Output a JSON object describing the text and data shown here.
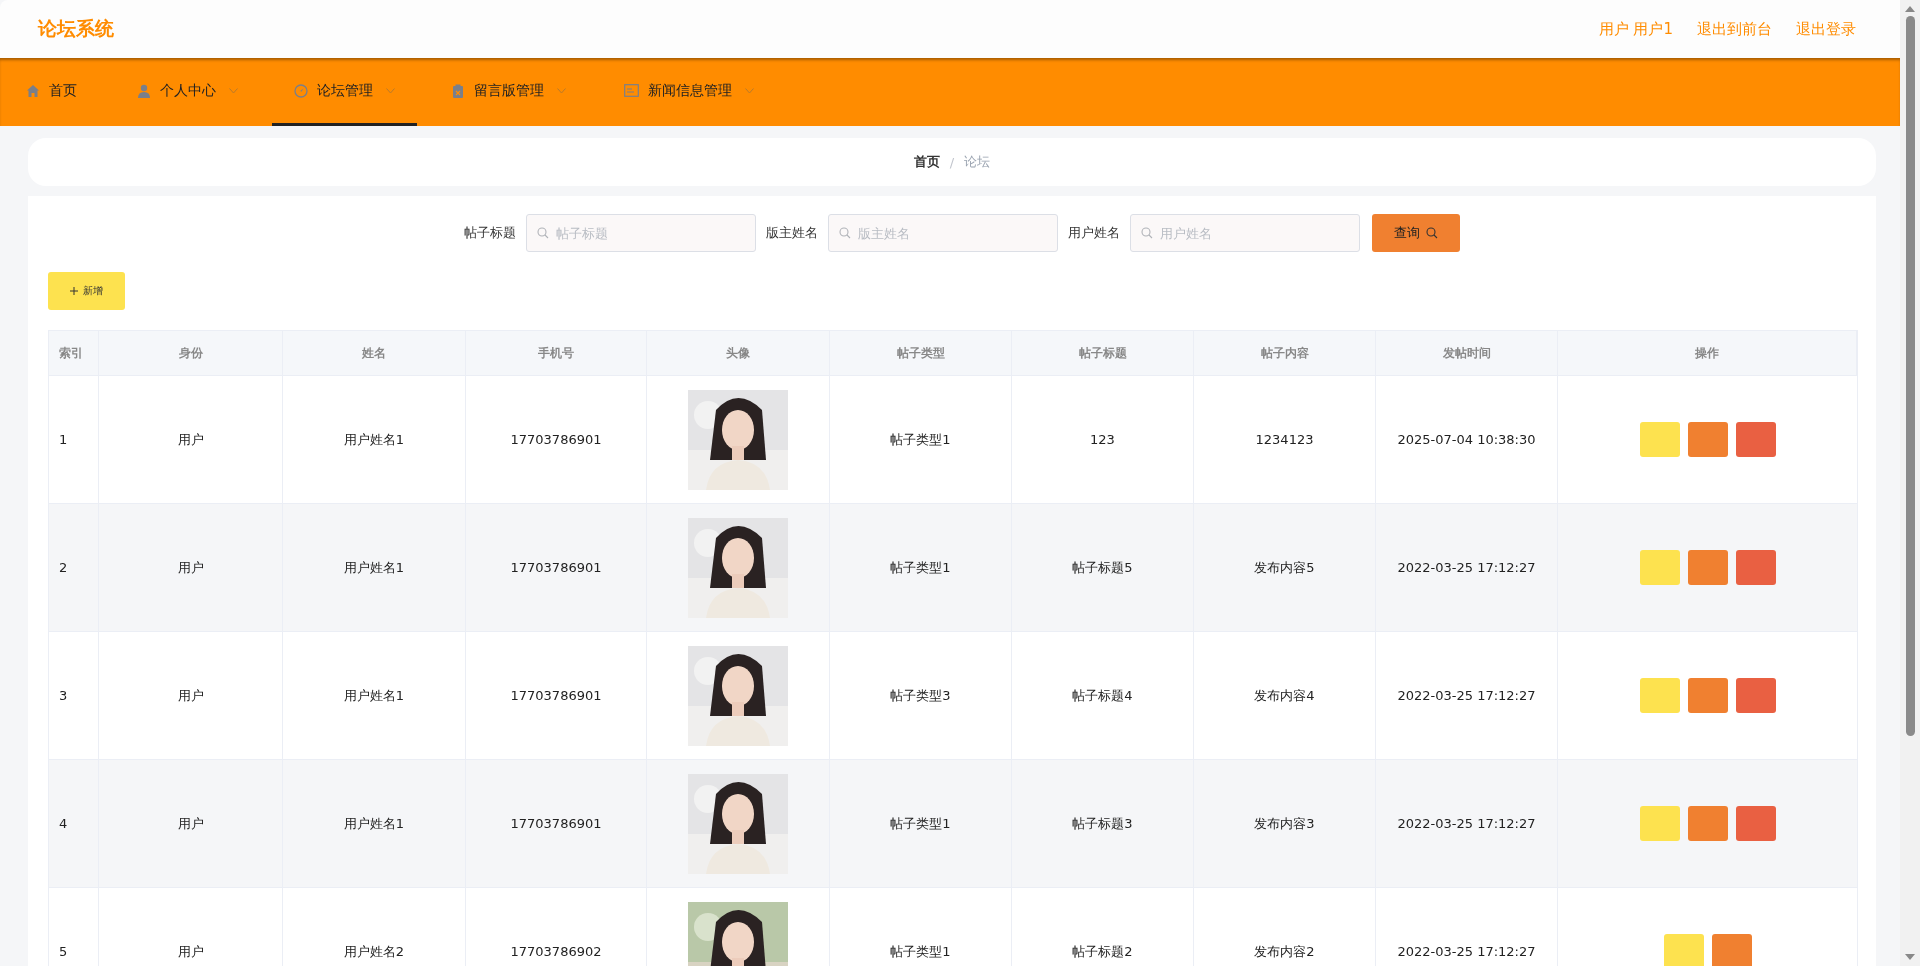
{
  "app_title": "论坛系统",
  "header_links": [
    "用户 用户1",
    "退出到前台",
    "退出登录"
  ],
  "nav": [
    {
      "label": "首页",
      "dropdown": false,
      "selected": false
    },
    {
      "label": "个人中心",
      "dropdown": true,
      "selected": false
    },
    {
      "label": "论坛管理",
      "dropdown": true,
      "selected": true
    },
    {
      "label": "留言版管理",
      "dropdown": true,
      "selected": false
    },
    {
      "label": "新闻信息管理",
      "dropdown": true,
      "selected": false
    }
  ],
  "breadcrumb": {
    "items": [
      "首页",
      "论坛"
    ],
    "separator": "/"
  },
  "search": {
    "fields": [
      {
        "label": "帖子标题",
        "placeholder": "帖子标题"
      },
      {
        "label": "版主姓名",
        "placeholder": "版主姓名"
      },
      {
        "label": "用户姓名",
        "placeholder": "用户姓名"
      }
    ],
    "button": "查询"
  },
  "add_button": "新增",
  "table": {
    "columns": [
      "索引",
      "身份",
      "姓名",
      "手机号",
      "头像",
      "帖子类型",
      "帖子标题",
      "帖子内容",
      "发帖时间",
      "操作"
    ],
    "rows": [
      {
        "index": "1",
        "role": "用户",
        "name": "用户姓名1",
        "phone": "17703786901",
        "avatar": {
          "kind": "picture"
        },
        "type": "帖子类型1",
        "title": "123",
        "content": "1234123",
        "time": "2025-07-04 10:38:30",
        "actions": [
          {
            "color": "#fde24f"
          },
          {
            "color": "#f08030"
          },
          {
            "color": "#e96042"
          }
        ]
      },
      {
        "index": "2",
        "role": "用户",
        "name": "用户姓名1",
        "phone": "17703786901",
        "avatar": {
          "kind": "picture"
        },
        "type": "帖子类型1",
        "title": "帖子标题5",
        "content": "发布内容5",
        "time": "2022-03-25 17:12:27",
        "actions": [
          {
            "color": "#fde24f"
          },
          {
            "color": "#f08030"
          },
          {
            "color": "#e96042"
          }
        ]
      },
      {
        "index": "3",
        "role": "用户",
        "name": "用户姓名1",
        "phone": "17703786901",
        "avatar": {
          "kind": "picture"
        },
        "type": "帖子类型3",
        "title": "帖子标题4",
        "content": "发布内容4",
        "time": "2022-03-25 17:12:27",
        "actions": [
          {
            "color": "#fde24f"
          },
          {
            "color": "#f08030"
          },
          {
            "color": "#e96042"
          }
        ]
      },
      {
        "index": "4",
        "role": "用户",
        "name": "用户姓名1",
        "phone": "17703786901",
        "avatar": {
          "kind": "picture"
        },
        "type": "帖子类型1",
        "title": "帖子标题3",
        "content": "发布内容3",
        "time": "2022-03-25 17:12:27",
        "actions": [
          {
            "color": "#fde24f"
          },
          {
            "color": "#f08030"
          },
          {
            "color": "#e96042"
          }
        ]
      },
      {
        "index": "5",
        "role": "用户",
        "name": "用户姓名2",
        "phone": "17703786902",
        "avatar": {
          "kind": "picture"
        },
        "type": "帖子类型1",
        "title": "帖子标题2",
        "content": "发布内容2",
        "time": "2022-03-25 17:12:27",
        "actions": [
          {
            "color": "#fde24f"
          },
          {
            "color": "#f08030"
          }
        ]
      }
    ]
  }
}
